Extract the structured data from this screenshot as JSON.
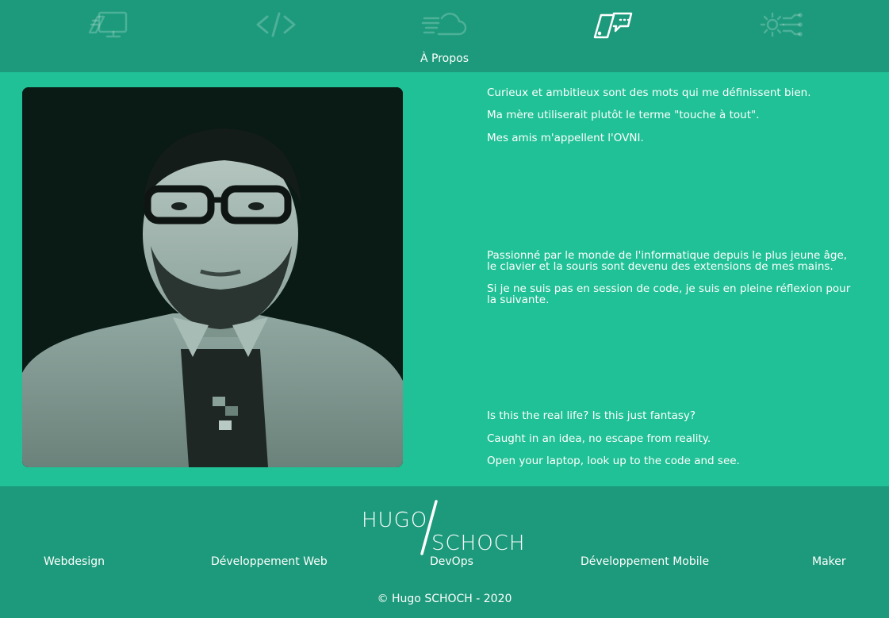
{
  "nav": {
    "items": [
      {
        "icon": "webdesign-icon",
        "active": false
      },
      {
        "icon": "code-icon",
        "active": false
      },
      {
        "icon": "cloud-devops-icon",
        "active": false
      },
      {
        "icon": "mobile-chat-icon",
        "active": true
      },
      {
        "icon": "gear-circuit-icon",
        "active": false
      }
    ],
    "active_label": "À Propos"
  },
  "about": {
    "block1": [
      "Curieux et ambitieux sont des mots qui me définissent bien.",
      "Ma mère utiliserait plutôt le terme \"touche à tout\".",
      "Mes amis m'appellent l'OVNI."
    ],
    "block2": [
      "Passionné par le monde de l'informatique depuis le plus jeune âge, le clavier et la souris sont devenu des extensions de mes mains.",
      "Si je ne suis pas en session de code, je suis en pleine réflexion pour la suivante."
    ],
    "block3": [
      "Is this the real life? Is this just fantasy?",
      "Caught in an idea, no escape from reality.",
      "Open your laptop, look up to the code and see."
    ]
  },
  "footer": {
    "logo_top": "HUGO",
    "logo_bottom": "SCHOCH",
    "links": [
      "Webdesign",
      "Développement Web",
      "DevOps",
      "Développement Mobile",
      "Maker"
    ],
    "copyright": "© Hugo SCHOCH - 2020"
  },
  "colors": {
    "nav_bg": "#1c9a7b",
    "main_bg": "#20c196",
    "text": "#ffffff"
  }
}
